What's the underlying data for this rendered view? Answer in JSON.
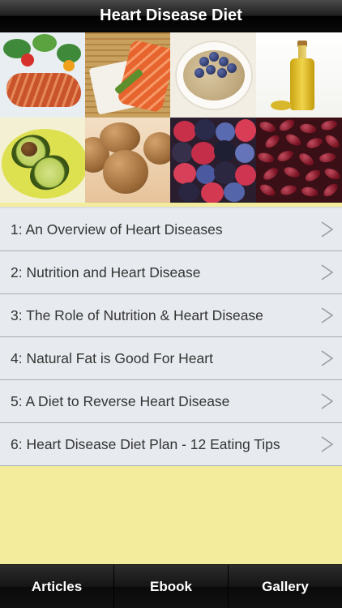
{
  "header": {
    "title": "Heart Disease Diet"
  },
  "banner": {
    "images": [
      "salmon-salad",
      "salmon-sushi",
      "oatmeal-blueberries",
      "olive-oil",
      "avocado",
      "walnuts",
      "berries",
      "kidney-beans"
    ]
  },
  "list": {
    "items": [
      {
        "label": "1: An Overview of Heart Diseases",
        "chevron": "chevron-right-icon"
      },
      {
        "label": "2: Nutrition and Heart Disease",
        "chevron": "chevron-right-icon"
      },
      {
        "label": "3: The Role of Nutrition & Heart Disease",
        "chevron": "chevron-right-icon"
      },
      {
        "label": "4: Natural Fat is Good For Heart",
        "chevron": "chevron-right-icon"
      },
      {
        "label": "5: A Diet to Reverse Heart Disease",
        "chevron": "chevron-right-icon"
      },
      {
        "label": "6: Heart Disease Diet Plan - 12 Eating Tips",
        "chevron": "chevron-right-icon"
      }
    ]
  },
  "tabbar": {
    "tabs": [
      {
        "label": "Articles"
      },
      {
        "label": "Ebook"
      },
      {
        "label": "Gallery"
      }
    ]
  },
  "colors": {
    "background": "#f3ec9c",
    "row": "#e7ebef",
    "header": "#000000"
  }
}
